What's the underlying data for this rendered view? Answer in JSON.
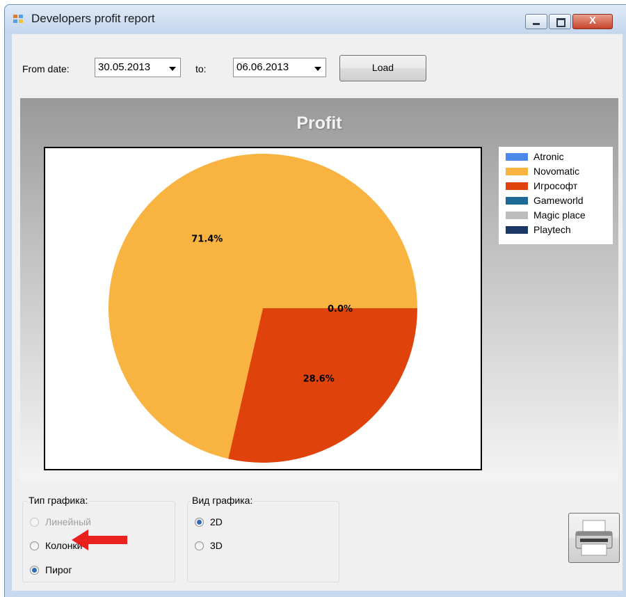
{
  "window": {
    "title": "Developers profit report",
    "controls": {
      "minimize_icon": "minimize-icon",
      "maximize_icon": "maximize-icon",
      "close_label": "X"
    }
  },
  "toolbar": {
    "from_label": "From date:",
    "from_value": "30.05.2013",
    "to_label": "to:",
    "to_value": "06.06.2013",
    "load_label": "Load"
  },
  "chart": {
    "title": "Profit"
  },
  "chart_data": {
    "type": "pie",
    "title": "Profit",
    "slices": [
      {
        "name": "Atronic",
        "percent": 0.0,
        "label": "0.0%",
        "color": "#4a89e8"
      },
      {
        "name": "Novomatic",
        "percent": 71.4,
        "label": "71.4%",
        "color": "#f9b341"
      },
      {
        "name": "Игрософт",
        "percent": 28.6,
        "label": "28.6%",
        "color": "#df420b"
      },
      {
        "name": "Gameworld",
        "percent": 0.0,
        "label": "0.0%",
        "color": "#1c6a95"
      },
      {
        "name": "Magic place",
        "percent": 0.0,
        "label": "0.0%",
        "color": "#bdbdbd"
      },
      {
        "name": "Playtech",
        "percent": 0.0,
        "label": "0.0%",
        "color": "#1c3766"
      }
    ],
    "legend_placement": "right"
  },
  "chart_type_group": {
    "caption": "Тип графика:",
    "options": [
      {
        "label": "Линейный",
        "checked": false,
        "disabled": true
      },
      {
        "label": "Колонки",
        "checked": false,
        "disabled": false
      },
      {
        "label": "Пирог",
        "checked": true,
        "disabled": false
      }
    ]
  },
  "chart_view_group": {
    "caption": "Вид графика:",
    "options": [
      {
        "label": "2D",
        "checked": true
      },
      {
        "label": "3D",
        "checked": false
      }
    ]
  },
  "print_button": {
    "icon": "printer-icon"
  },
  "annotation": {
    "color": "#e8201e",
    "icon": "red-arrow"
  }
}
